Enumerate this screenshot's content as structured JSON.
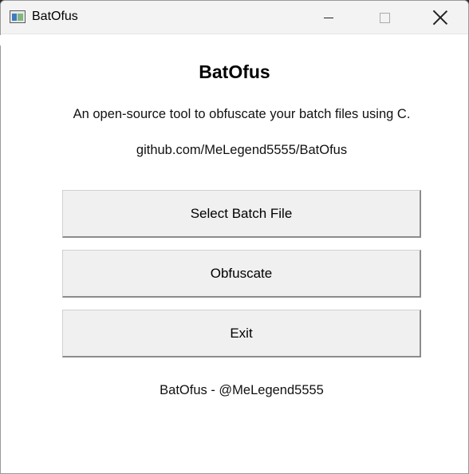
{
  "window": {
    "title": "BatOfus",
    "icon": "app-window-icon",
    "controls": [
      "minimize-icon",
      "maximize-icon",
      "close-icon"
    ]
  },
  "main": {
    "heading": "BatOfus",
    "description": "An open-source tool to obfuscate your batch files using C.",
    "repo": "github.com/MeLegend5555/BatOfus",
    "buttons": {
      "select": "Select Batch File",
      "obfuscate": "Obfuscate",
      "exit": "Exit"
    },
    "footer": "BatOfus - @MeLegend5555"
  }
}
